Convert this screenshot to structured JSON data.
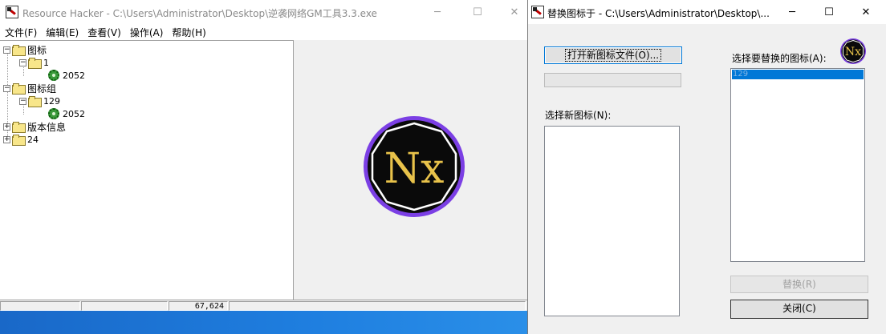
{
  "main_window": {
    "title": "Resource Hacker  -  C:\\Users\\Administrator\\Desktop\\逆袭网络GM工具3.3.exe",
    "window_buttons": {
      "minimize": "─",
      "maximize": "☐",
      "close": "✕"
    },
    "menu": [
      "文件(F)",
      "编辑(E)",
      "查看(V)",
      "操作(A)",
      "帮助(H)"
    ],
    "tree": {
      "icon_group": {
        "label": "图标",
        "expander": "−"
      },
      "icon_1": {
        "label": "1",
        "expander": "−"
      },
      "icon_1_res": {
        "label": "2052"
      },
      "icongroup_group": {
        "label": "图标组",
        "expander": "−"
      },
      "icongroup_129": {
        "label": "129",
        "expander": "−"
      },
      "icongroup_129_res": {
        "label": "2052"
      },
      "version_group": {
        "label": "版本信息",
        "expander": "+"
      },
      "group_24": {
        "label": "24",
        "expander": "+"
      }
    },
    "preview_icon_text": "Nx",
    "status": [
      "",
      "",
      "",
      "67,624"
    ]
  },
  "dialog": {
    "title": "替换图标于 - C:\\Users\\Administrator\\Desktop\\...",
    "window_buttons": {
      "minimize": "─",
      "maximize": "☐",
      "close": "✕"
    },
    "open_file_button": "打开新图标文件(O)...",
    "new_icon_label": "选择新图标(N):",
    "target_icon_label": "选择要替换的图标(A):",
    "target_list": [
      "129"
    ],
    "replace_button": "替换(R)",
    "close_button": "关闭(C)",
    "corner_icon_text": "Nx"
  },
  "colors": {
    "nx_ring": "#7b3fe4",
    "nx_fill": "#0a0a0a",
    "nx_text": "#e8c24a",
    "selection": "#0078d7",
    "desktop": "#1f7fe0"
  }
}
